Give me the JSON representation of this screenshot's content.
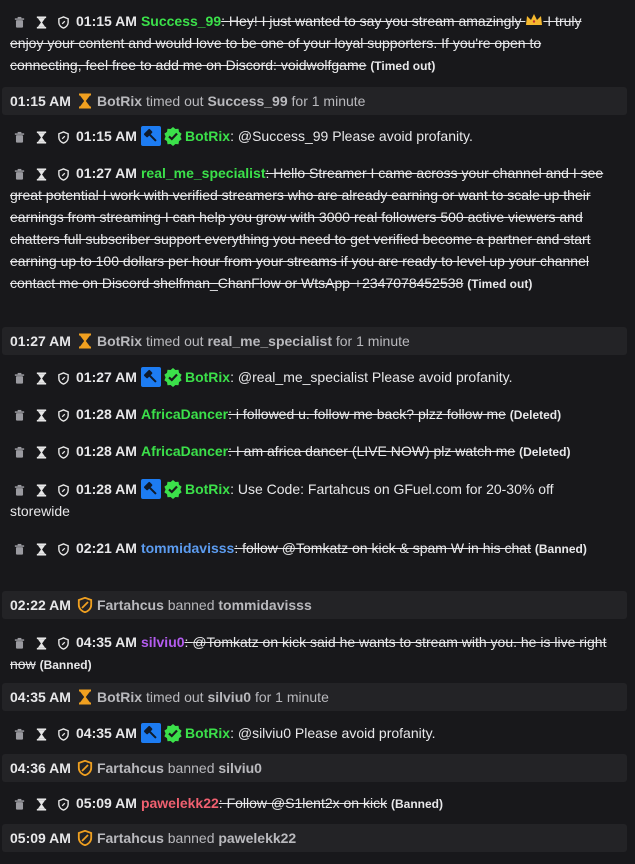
{
  "colors": {
    "background": "#18181b",
    "event_row": "#232326",
    "green_user": "#3be04a",
    "blue_user": "#5c9cf0",
    "purple_user": "#b45cf0",
    "red_user": "#f06070",
    "timeout_orange": "#f0a020",
    "mod_badge": "#1d7cf2",
    "verified_green": "#3be04a"
  },
  "icons": {
    "delete": "trash-icon",
    "timeout": "hourglass-icon",
    "ban": "shield-icon",
    "moderator": "gavel-badge-icon",
    "verified": "verified-check-icon",
    "crown": "crown-icon"
  },
  "messages": {
    "m1": {
      "time": "01:15 AM",
      "user": "Success_99",
      "text": "Hey! I just wanted to say you stream amazingly",
      "text2": "I truly enjoy your content and would love to be one of your loyal supporters. If you're open to connecting, feel free to add me on Discord: voidwolfgame",
      "tag": "(Timed out)"
    },
    "m2": {
      "time": "01:15 AM",
      "user": "BotRix",
      "text": "@Success_99 Please avoid profanity."
    },
    "m3": {
      "time": "01:27 AM",
      "user": "real_me_specialist",
      "text": "Hello Streamer I came across your channel and I see great potential I work with verified streamers who are already earning or want to scale up their earnings from streaming I can help you grow with 3000 real followers 500 active viewers and chatters full subscriber support everything you need to get verified become a partner and start earning up to 100 dollars per hour from your streams if you are ready to level up your channel contact me on Discord shelfman_ChanFlow or WtsApp +2347078452538",
      "tag": "(Timed out)"
    },
    "m4": {
      "time": "01:27 AM",
      "user": "BotRix",
      "text": "@real_me_specialist Please avoid profanity."
    },
    "m5": {
      "time": "01:28 AM",
      "user": "AfricaDancer",
      "text": "i followed u. follow me back? plzz follow me",
      "tag": "(Deleted)"
    },
    "m6": {
      "time": "01:28 AM",
      "user": "AfricaDancer",
      "text": "I am africa dancer (LIVE NOW) plz watch me",
      "tag": "(Deleted)"
    },
    "m7": {
      "time": "01:28 AM",
      "user": "BotRix",
      "text": "Use Code: Fartahcus on GFuel.com for 20-30% off storewide"
    },
    "m8": {
      "time": "02:21 AM",
      "user": "tommidavisss",
      "text": "follow @Tomkatz on kick & spam W in his chat",
      "tag": "(Banned)"
    },
    "m9": {
      "time": "04:35 AM",
      "user": "silviu0",
      "text": "@Tomkatz on kick said he wants to stream with you. he is live right now",
      "tag": "(Banned)"
    },
    "m10": {
      "time": "04:35 AM",
      "user": "BotRix",
      "text": "@silviu0 Please avoid profanity."
    },
    "m11": {
      "time": "05:09 AM",
      "user": "pawelekk22",
      "text": "Follow @S1lent2x on kick",
      "tag": "(Banned)"
    }
  },
  "events": {
    "e1": {
      "time": "01:15 AM",
      "actor": "BotRix",
      "action": "timed out",
      "target": "Success_99",
      "suffix": "for 1 minute"
    },
    "e2": {
      "time": "01:27 AM",
      "actor": "BotRix",
      "action": "timed out",
      "target": "real_me_specialist",
      "suffix": "for 1 minute"
    },
    "e3": {
      "time": "02:22 AM",
      "actor": "Fartahcus",
      "action": "banned",
      "target": "tommidavisss"
    },
    "e4": {
      "time": "04:35 AM",
      "actor": "BotRix",
      "action": "timed out",
      "target": "silviu0",
      "suffix": "for 1 minute"
    },
    "e5": {
      "time": "04:36 AM",
      "actor": "Fartahcus",
      "action": "banned",
      "target": "silviu0"
    },
    "e6": {
      "time": "05:09 AM",
      "actor": "Fartahcus",
      "action": "banned",
      "target": "pawelekk22"
    }
  }
}
